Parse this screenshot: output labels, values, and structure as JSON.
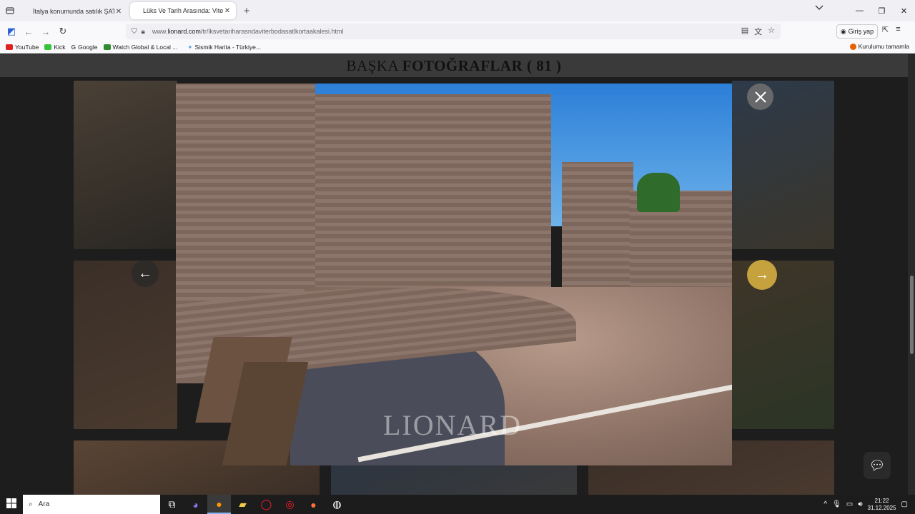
{
  "browser": {
    "tabs": [
      {
        "title": "İtalya konumunda satılık ŞATO | ",
        "active": false
      },
      {
        "title": "Lüks Ve Tarih Arasında: Viterbo",
        "active": true
      }
    ],
    "url_prefix": "www.",
    "url_domain": "lionard.com",
    "url_path": "/tr/lksvetariharasndaviterbodasatlkortaakalesi.html",
    "signin_label": "Giriş yap",
    "bookmarks": [
      {
        "label": "YouTube",
        "color": "#e02020"
      },
      {
        "label": "Kick",
        "color": "#36c23a"
      },
      {
        "label": "Google",
        "color": "#4285f4"
      },
      {
        "label": "Watch Global & Local ...",
        "color": "#2e8b2e"
      },
      {
        "label": "Sismik Harita - Türkiye...",
        "color": "#5aa0e0"
      }
    ],
    "bookmark_right": "Kurulumu tamamla"
  },
  "page": {
    "heading_prefix": "BAŞKA",
    "heading_bold": "FOTOĞRAFLAR ( 81 )",
    "watermark": "LIONARD",
    "accent_color": "#c5a23e"
  },
  "taskbar": {
    "search_placeholder": "Ara",
    "time": "21:22",
    "date": "31.12.2025"
  },
  "icons": [
    "tab-list-icon",
    "close-icon",
    "plus-icon",
    "chevron-down-icon",
    "minimize-icon",
    "maximize-icon",
    "back-icon",
    "forward-icon",
    "reload-icon",
    "shield-icon",
    "lock-icon",
    "reader-icon",
    "translate-icon",
    "star-icon",
    "account-icon",
    "extensions-icon",
    "menu-icon",
    "arrow-left-icon",
    "arrow-right-icon",
    "chat-icon",
    "windows-icon",
    "search-icon"
  ]
}
